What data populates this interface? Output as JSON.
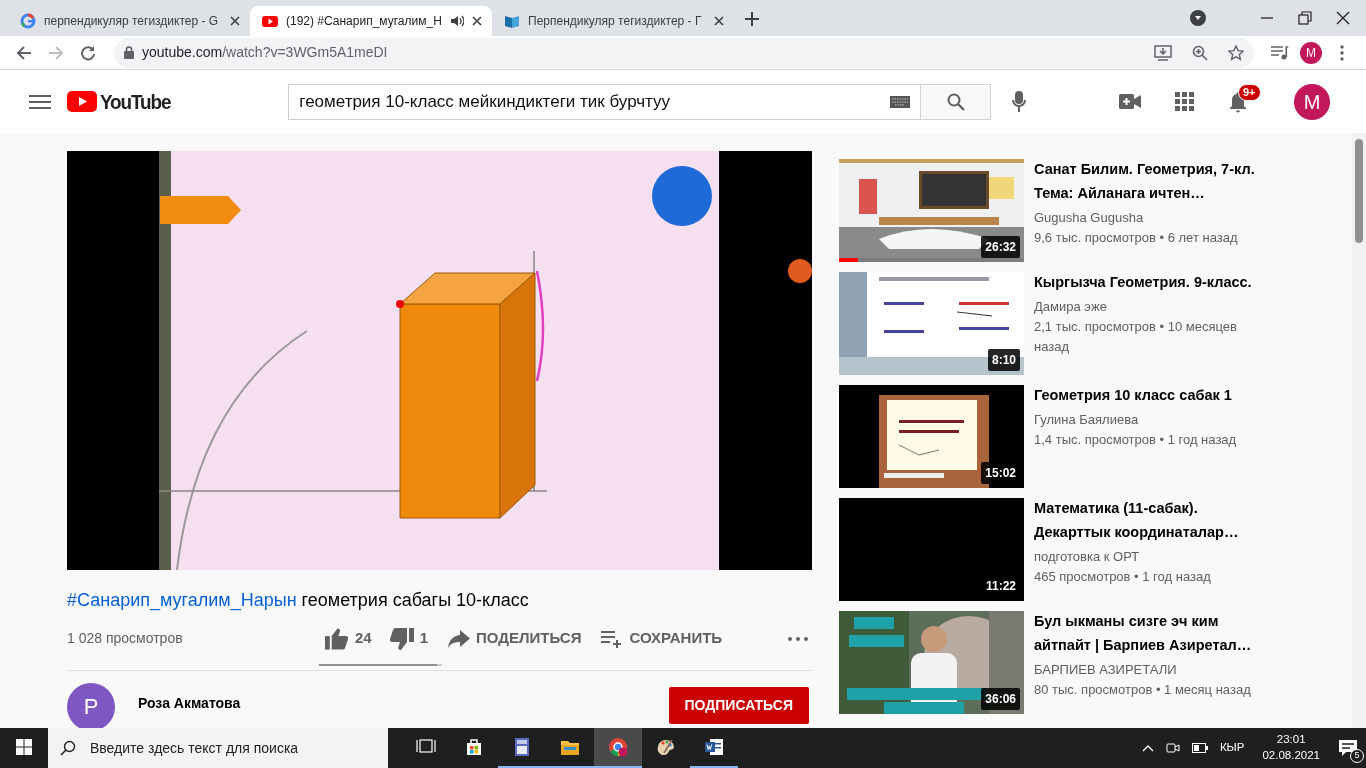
{
  "browser": {
    "tabs": [
      {
        "title": "перпендикуляр тегиздиктер - G",
        "audio": false,
        "selected": false
      },
      {
        "title": "(192) #Санарип_мугалим_Н",
        "audio": true,
        "selected": true
      },
      {
        "title": "Перпендикуляр тегиздиктер - Г",
        "audio": false,
        "selected": false
      }
    ],
    "url_host": "youtube.com",
    "url_path": "/watch?v=3WGm5A1meDI",
    "profile": "M"
  },
  "header": {
    "logo": "YouTube",
    "search": "геометрия 10-класс мейкиндиктеги тик бурчтуу",
    "notifications": "9+",
    "avatar": "M"
  },
  "video": {
    "hashtag": "#Санарип_мугалим_Нарын",
    "title": "геометрия сабагы 10-класс",
    "views": "1 028 просмотров",
    "likes": "24",
    "dislikes": "1",
    "share": "ПОДЕЛИТЬСЯ",
    "save": "СОХРАНИТЬ",
    "sentiment": {
      "level": 0.96
    }
  },
  "channel": {
    "avatar": "Р",
    "name": "Роза Акматова",
    "subscribe": "ПОДПИСАТЬСЯ"
  },
  "recommendations": [
    {
      "title": "Санат Билим. Геометрия, 7-кл. Тема: Айланага ичтен…",
      "channel": "Gugusha Gugusha",
      "meta": "9,6 тыс. просмотров • 6 лет назад",
      "duration": "26:32",
      "watched": {
        "level": 0.1
      }
    },
    {
      "title": "Кыргызча Геометрия. 9-класс.",
      "channel": "Дамира эже",
      "meta": "2,1 тыс. просмотров • 10 месяцев назад",
      "duration": "8:10"
    },
    {
      "title": "Геометрия 10 класс сабак 1",
      "channel": "Гулина Баялиева",
      "meta": "1,4 тыс. просмотров • 1 год назад",
      "duration": "15:02"
    },
    {
      "title": "Математика (11-сабак). Декарттык координаталар…",
      "channel": "подготовка к ОРТ",
      "meta": "465 просмотров • 1 год назад",
      "duration": "11:22"
    },
    {
      "title": "Бул ыкманы сизге эч ким айтпайт | Барпиев Азиретал…",
      "channel": "БАРПИЕВ АЗИРЕТАЛИ",
      "meta": "80 тыс. просмотров • 1 месяц назад",
      "duration": "36:06"
    }
  ],
  "taskbar": {
    "search": {
      "placeholder": "Введите здесь текст для поиска"
    },
    "apps": [
      {
        "kind": "taskview",
        "running": false,
        "selected": false
      },
      {
        "kind": "store",
        "running": false,
        "selected": false
      },
      {
        "kind": "calculator",
        "running": true,
        "selected": false
      },
      {
        "kind": "explorer",
        "running": true,
        "selected": false
      },
      {
        "kind": "chrome",
        "running": true,
        "selected": true
      },
      {
        "kind": "paint",
        "running": false,
        "selected": false
      },
      {
        "kind": "word",
        "running": true,
        "selected": false
      }
    ],
    "language": "КЫР",
    "time": "23:01",
    "date": "02.08.2021",
    "notifications": "5"
  }
}
